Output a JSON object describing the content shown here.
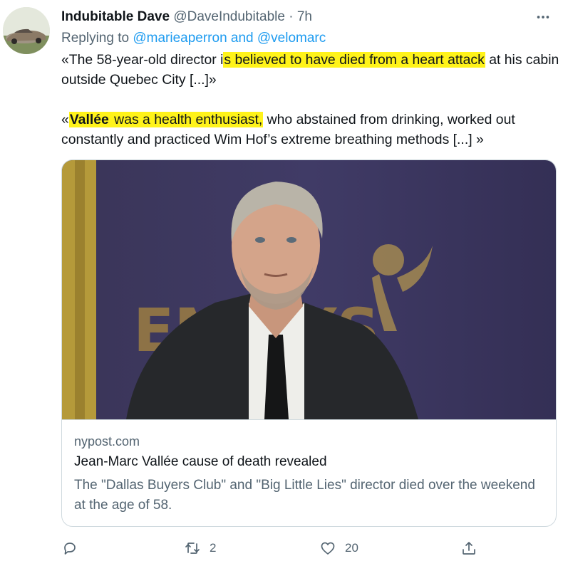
{
  "tweet": {
    "author_name": "Indubitable Dave",
    "handle": "@DaveIndubitable",
    "separator": "·",
    "time": "7h",
    "replying_prefix": "Replying to ",
    "reply_mentions": "@marieaperron and @velomarc",
    "text": {
      "p1_before": "«The 58-year-old director i",
      "p1_highlight": "s believed to have died from a heart attack",
      "p1_after": " at his cabin outside Quebec City [...]»",
      "p2_open": "«",
      "p2_bold_highlight": "Vallée",
      "p2_highlight": " was a health enthusiast,",
      "p2_after": " who abstained from drinking, worked out constantly and practiced Wim Hof’s extreme breathing methods [...] »"
    },
    "highlight_color": "#fff31a"
  },
  "card": {
    "domain": "nypost.com",
    "title": "Jean-Marc Vallée cause of death revealed",
    "description": "The \"Dallas Buyers Club\" and \"Big Little Lies\" director died over the weekend at the age of 58.",
    "image_backdrop_text": "EMMYS"
  },
  "actions": {
    "reply_count": "",
    "retweet_count": "2",
    "like_count": "20"
  },
  "colors": {
    "text_primary": "#0f1419",
    "text_secondary": "#536471",
    "link_blue": "#1d9bf0",
    "border": "#cfd9de"
  },
  "icons": [
    "more-icon",
    "reply-icon",
    "retweet-icon",
    "like-icon",
    "share-icon"
  ]
}
